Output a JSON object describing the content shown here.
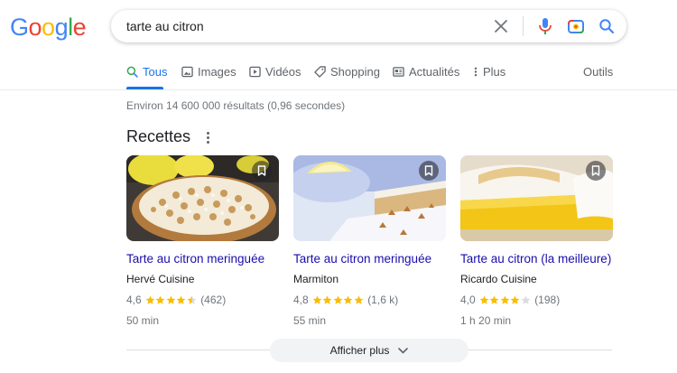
{
  "logo": {
    "letters": [
      "G",
      "o",
      "o",
      "g",
      "l",
      "e"
    ],
    "colors": [
      "#4285f4",
      "#ea4335",
      "#fbbc05",
      "#4285f4",
      "#34a853",
      "#ea4335"
    ]
  },
  "search": {
    "query": "tarte au citron",
    "icons": [
      "close-icon",
      "mic-icon",
      "camera-lens-icon",
      "search-icon"
    ]
  },
  "tabs": [
    {
      "label": "Tous",
      "icon": "search-icon",
      "active": true
    },
    {
      "label": "Images",
      "icon": "image-icon"
    },
    {
      "label": "Vidéos",
      "icon": "video-icon"
    },
    {
      "label": "Shopping",
      "icon": "tag-icon"
    },
    {
      "label": "Actualités",
      "icon": "news-icon"
    },
    {
      "label": "Plus",
      "icon": "more-vert-icon"
    }
  ],
  "tools_label": "Outils",
  "stats": "Environ 14 600 000 résultats (0,96 secondes)",
  "recipes": {
    "title": "Recettes",
    "cards": [
      {
        "title": "Tarte au citron meringuée",
        "source": "Hervé Cuisine",
        "rating": "4,6",
        "stars": 4.5,
        "reviews": "(462)",
        "time": "50 min"
      },
      {
        "title": "Tarte au citron meringuée",
        "source": "Marmiton",
        "rating": "4,8",
        "stars": 5,
        "reviews": "(1,6 k)",
        "time": "55 min"
      },
      {
        "title": "Tarte au citron (la meilleure)",
        "source": "Ricardo Cuisine",
        "rating": "4,0",
        "stars": 4,
        "reviews": "(198)",
        "time": "1 h 20 min"
      }
    ],
    "show_more": "Afficher plus"
  },
  "colors": {
    "link": "#1a0dab",
    "accent": "#1a73e8",
    "star": "#fbbc04",
    "muted": "#70757a"
  }
}
